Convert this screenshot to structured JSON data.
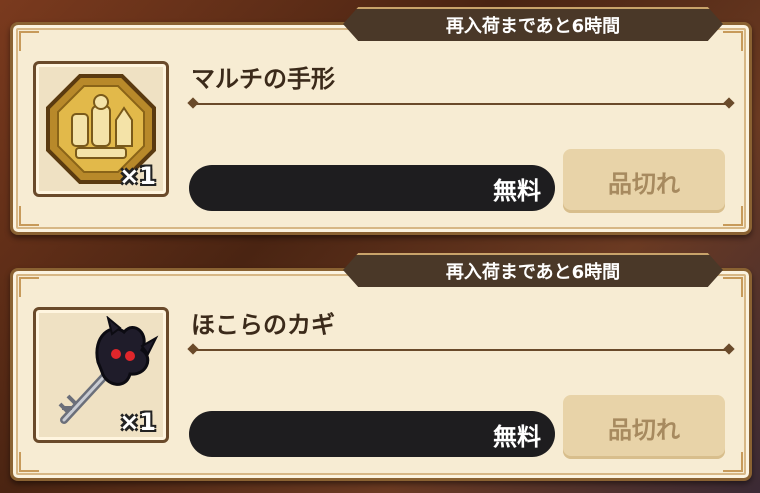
{
  "items": [
    {
      "restock_label": "再入荷まであと6時間",
      "name": "マルチの手形",
      "quantity": "×1",
      "icon": "multi-pass-medal-icon",
      "price_label": "無料",
      "button_label": "品切れ"
    },
    {
      "restock_label": "再入荷まであと6時間",
      "name": "ほこらのカギ",
      "quantity": "×1",
      "icon": "shrine-key-icon",
      "price_label": "無料",
      "button_label": "品切れ"
    }
  ]
}
